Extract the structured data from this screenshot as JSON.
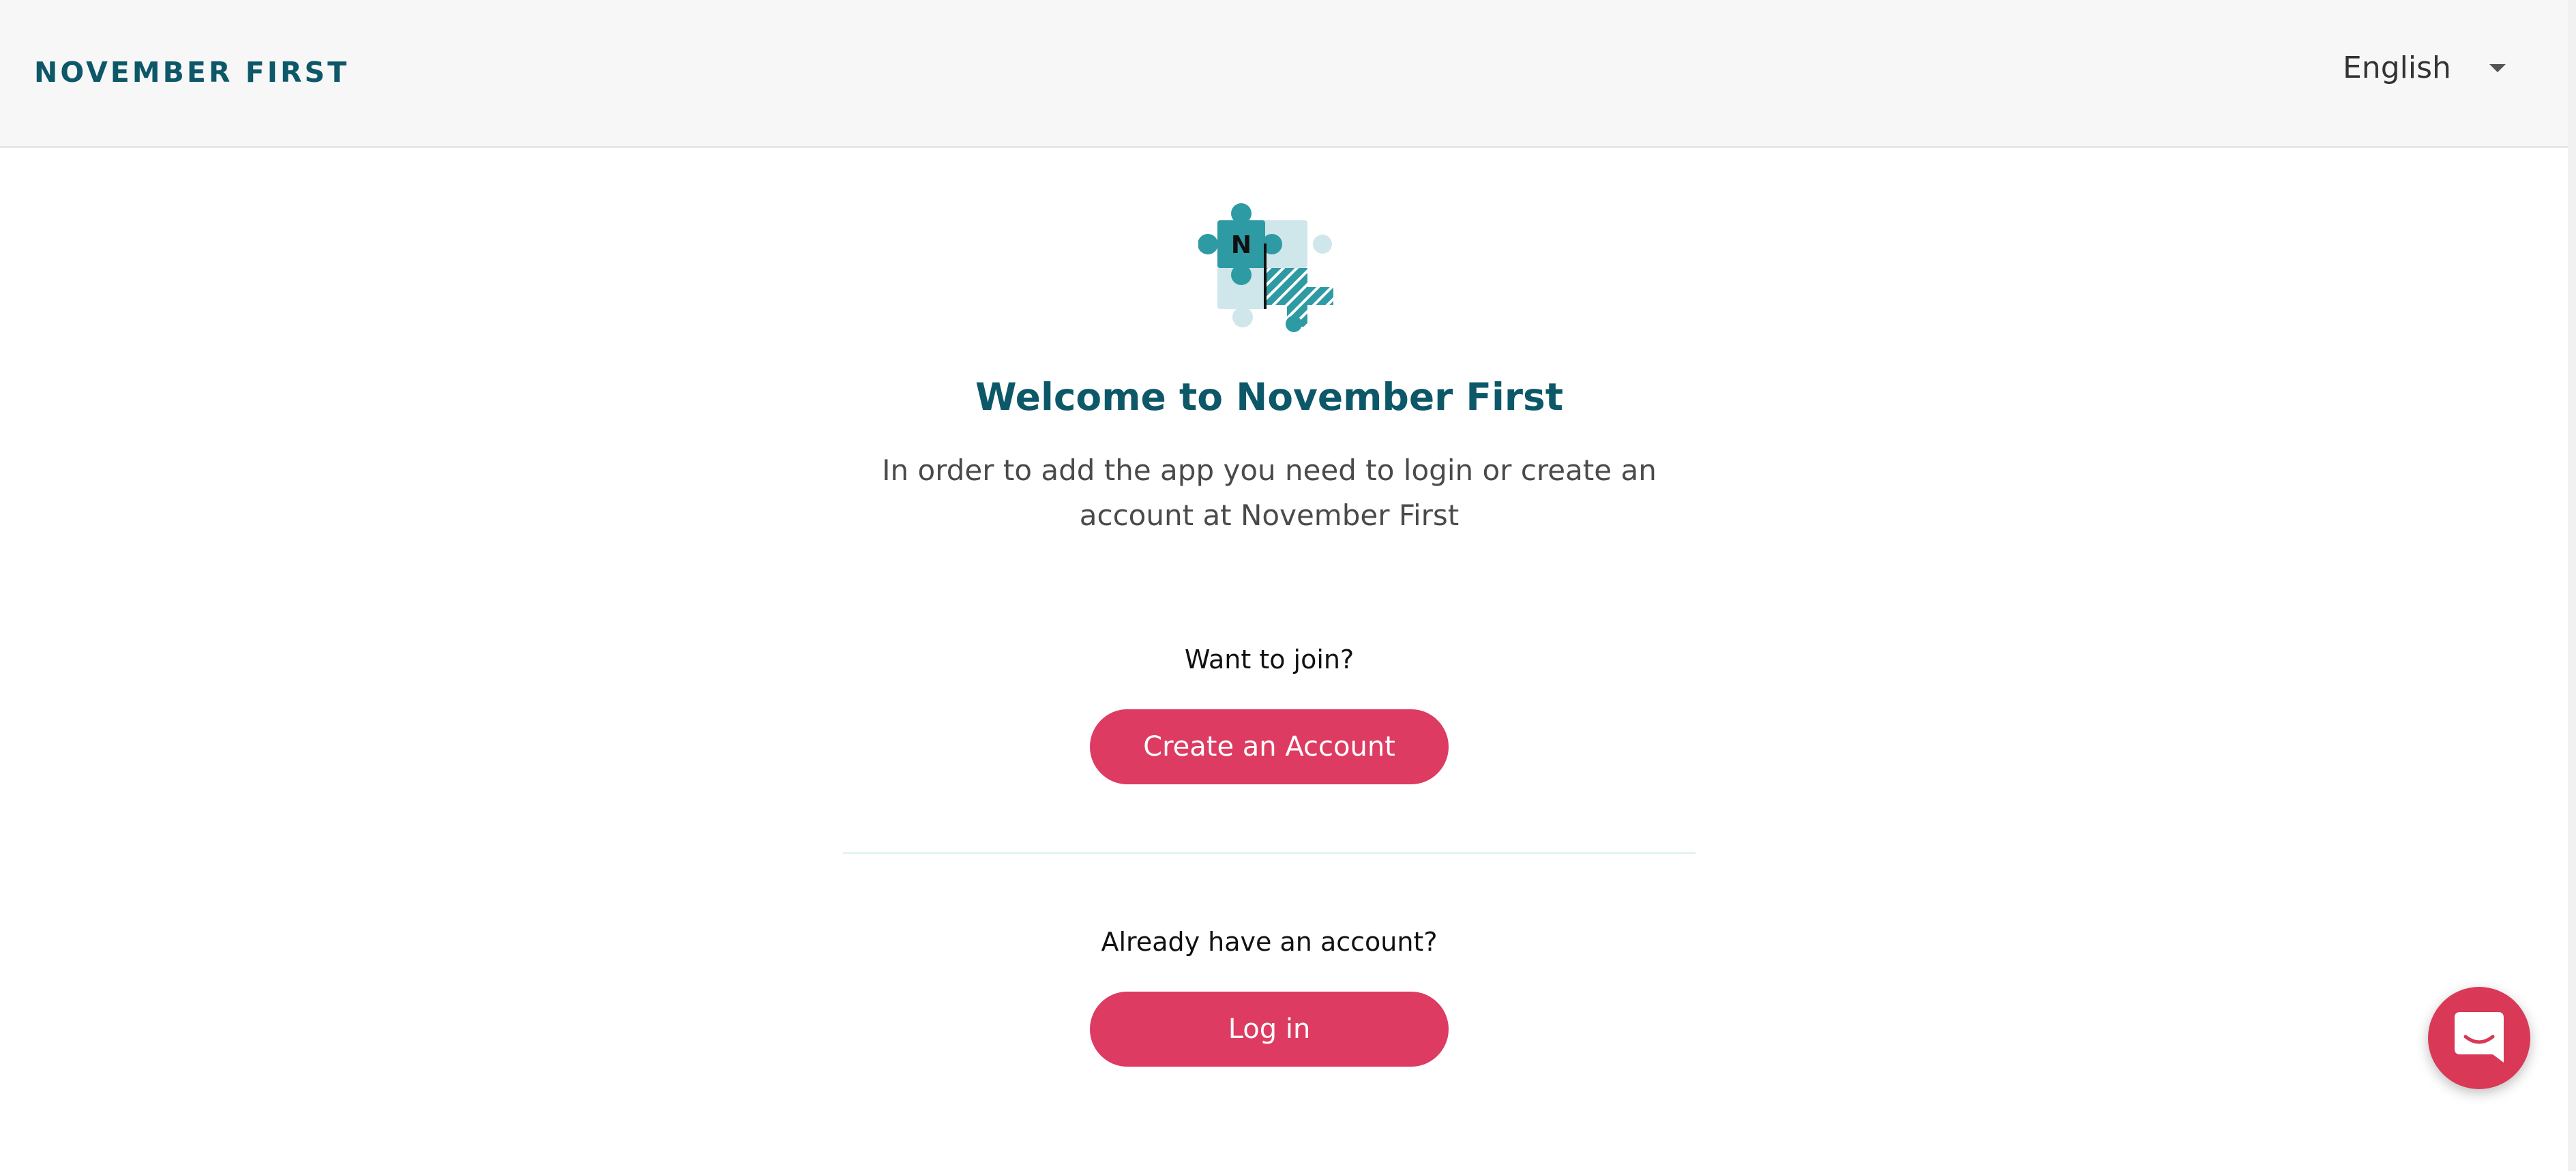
{
  "header": {
    "brand": "NOVEMBER FIRST",
    "language": "English"
  },
  "main": {
    "title": "Welcome to November First",
    "subtitle": "In order to add the app you need to login or create an account at November First",
    "join_question": "Want to join?",
    "create_button": "Create an Account",
    "login_question": "Already have an account?",
    "login_button": "Log in"
  },
  "logo": {
    "icon": "puzzle-pieces-icon",
    "letter": "N"
  },
  "chat": {
    "icon": "chat-bubble-icon"
  },
  "colors": {
    "brand": "#0d5868",
    "accent": "#dd3b62",
    "header_bg": "#f7f7f7",
    "puzzle_teal": "#2e9aa3",
    "puzzle_light": "#cfe6ea"
  }
}
